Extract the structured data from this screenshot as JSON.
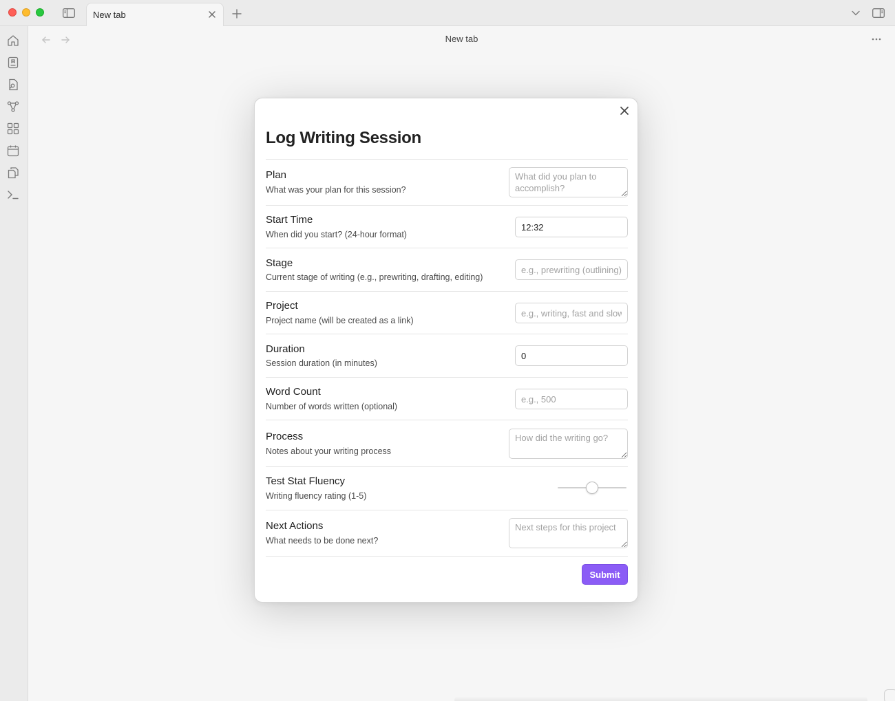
{
  "window": {
    "tab_title": "New tab",
    "view_title": "New tab"
  },
  "ribbon": {
    "icons": [
      "home-icon",
      "bookmark-icon",
      "search-file-icon",
      "graph-icon",
      "grid-icon",
      "calendar-icon",
      "copy-icon",
      "terminal-icon"
    ]
  },
  "modal": {
    "title": "Log Writing Session",
    "fields": {
      "plan": {
        "name": "Plan",
        "desc": "What was your plan for this session?",
        "placeholder": "What did you plan to accomplish?",
        "value": ""
      },
      "start_time": {
        "name": "Start Time",
        "desc": "When did you start? (24-hour format)",
        "placeholder": "",
        "value": "12:32"
      },
      "stage": {
        "name": "Stage",
        "desc": "Current stage of writing (e.g., prewriting, drafting, editing)",
        "placeholder": "e.g., prewriting (outlining)",
        "value": ""
      },
      "project": {
        "name": "Project",
        "desc": "Project name (will be created as a link)",
        "placeholder": "e.g., writing, fast and slow",
        "value": ""
      },
      "duration": {
        "name": "Duration",
        "desc": "Session duration (in minutes)",
        "placeholder": "",
        "value": "0"
      },
      "word_count": {
        "name": "Word Count",
        "desc": "Number of words written (optional)",
        "placeholder": "e.g., 500",
        "value": ""
      },
      "process": {
        "name": "Process",
        "desc": "Notes about your writing process",
        "placeholder": "How did the writing go?",
        "value": ""
      },
      "fluency": {
        "name": "Test Stat Fluency",
        "desc": "Writing fluency rating (1-5)",
        "min": 1,
        "max": 5,
        "value": 3
      },
      "next_actions": {
        "name": "Next Actions",
        "desc": "What needs to be done next?",
        "placeholder": "Next steps for this project",
        "value": ""
      }
    },
    "submit_label": "Submit",
    "accent_color": "#8b5cf6"
  }
}
